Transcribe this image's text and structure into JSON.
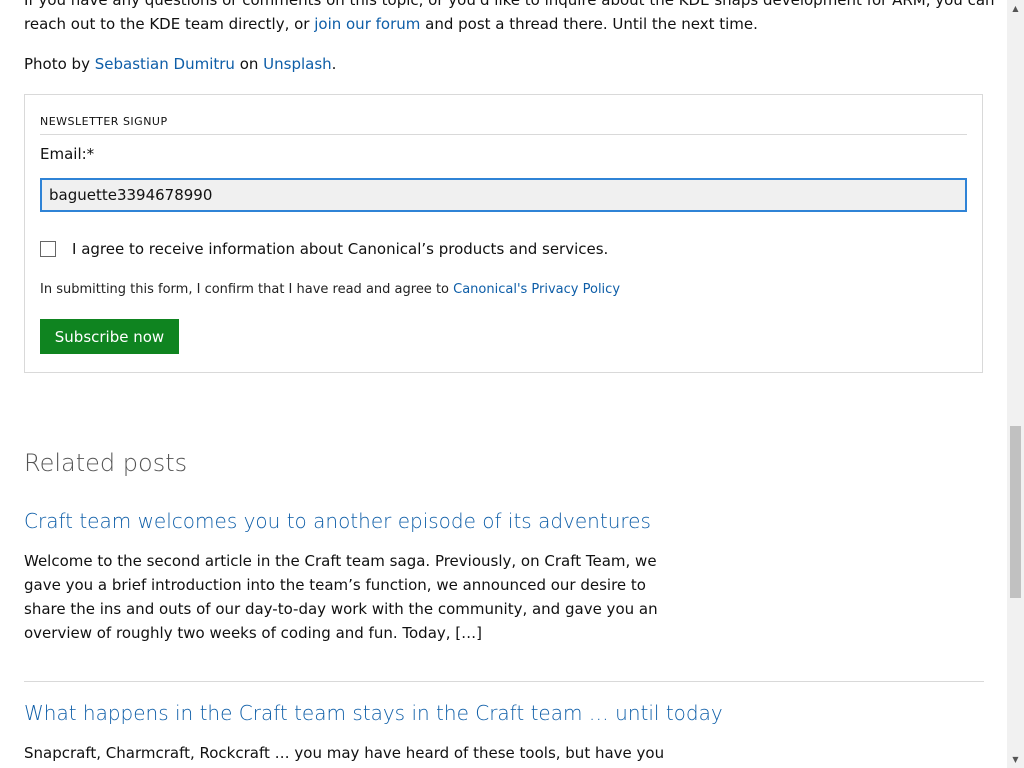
{
  "article": {
    "intro_line1": "If you have any questions or comments on this topic, or you'd like to inquire about the KDE snaps development for ARM, you can",
    "intro_line2_before": "reach out to the KDE team directly, or ",
    "forum_link": "join our forum",
    "intro_line2_after": " and post a thread there. Until the next time.",
    "photo_prefix": "Photo by ",
    "photographer_link": "Sebastian Dumitru",
    "photo_on": " on ",
    "unsplash_link": "Unsplash",
    "photo_suffix": "."
  },
  "newsletter": {
    "heading": "NEWSLETTER SIGNUP",
    "email_label": "Email:*",
    "email_value": "baguette3394678990",
    "consent_label": "I agree to receive information about Canonical’s products and services.",
    "consent_checked": false,
    "privacy_prefix": "In submitting this form, I confirm that I have read and agree to ",
    "privacy_link": "Canonical's Privacy Policy",
    "subscribe_label": "Subscribe now"
  },
  "related": {
    "heading": "Related posts",
    "posts": [
      {
        "title": "Craft team welcomes you to another episode of its adventures",
        "excerpt": "Welcome to the second article in the Craft team saga. Previously, on Craft Team, we gave you a brief introduction into the team’s function, we announced our desire to share the ins and outs of our day-to-day work with the community, and gave you an overview of roughly two weeks of coding and fun. Today, […]"
      },
      {
        "title": "What happens in the Craft team stays in the Craft team … until today",
        "excerpt": "Snapcraft, Charmcraft, Rockcraft … you may have heard of these tools, but have you"
      }
    ]
  },
  "colors": {
    "link": "#0e5ea8",
    "button": "#0f8420",
    "input_focus": "#2f83d6"
  },
  "icons": {
    "scroll_up": "up-arrow-icon",
    "scroll_down": "down-arrow-icon"
  }
}
